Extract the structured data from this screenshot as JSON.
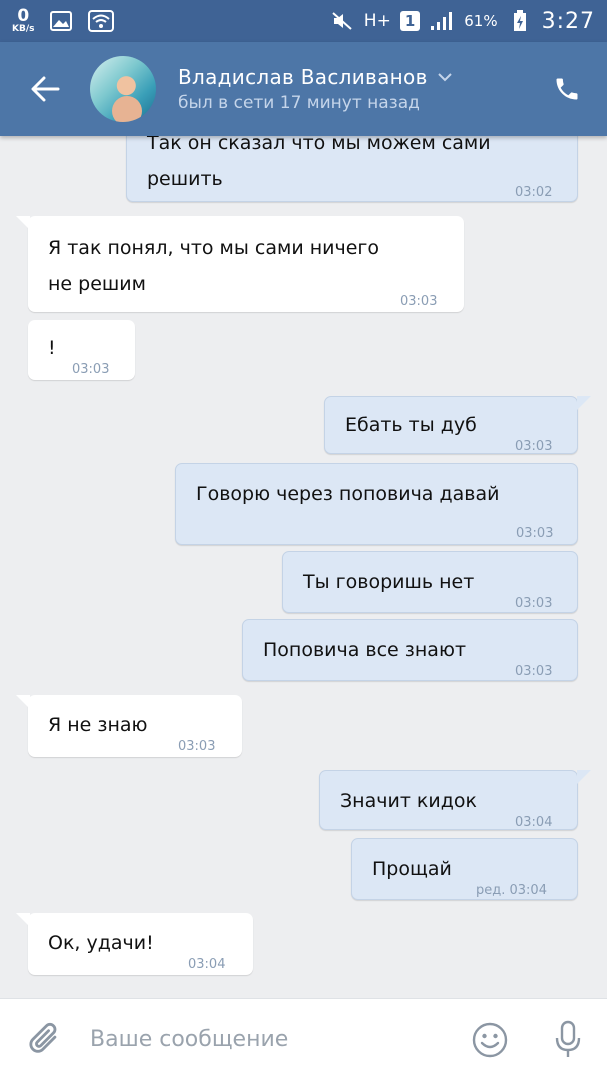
{
  "status_bar": {
    "speed_value": "0",
    "speed_unit": "KB/s",
    "network": "H+",
    "sim": "1",
    "battery_percent": "61%",
    "time": "3:27"
  },
  "header": {
    "contact_name": "Владислав Васливанов",
    "contact_status": "был в сети 17 минут назад"
  },
  "messages": [
    {
      "side": "out",
      "text": "Так он сказал что мы можем сами\nрешить",
      "time": "03:02"
    },
    {
      "side": "in",
      "text": "Я так понял, что мы сами ничего\nне решим",
      "time": "03:03"
    },
    {
      "side": "in",
      "text": "!",
      "time": "03:03"
    },
    {
      "side": "out",
      "text": "Ебать ты дуб",
      "time": "03:03"
    },
    {
      "side": "out",
      "text": "Говорю через поповича давай",
      "time": "03:03"
    },
    {
      "side": "out",
      "text": "Ты говоришь нет",
      "time": "03:03"
    },
    {
      "side": "out",
      "text": "Поповича все знают",
      "time": "03:03"
    },
    {
      "side": "in",
      "text": "Я не знаю",
      "time": "03:03"
    },
    {
      "side": "out",
      "text": "Значит кидок",
      "time": "03:04"
    },
    {
      "side": "out",
      "text": "Прощай",
      "time": "ред. 03:04"
    },
    {
      "side": "in",
      "text": "Ок, удачи!",
      "time": "03:04"
    }
  ],
  "composer": {
    "placeholder": "Ваше сообщение"
  },
  "colors": {
    "status_bar": "#3f6395",
    "header": "#4d76a7",
    "background": "#edeef0",
    "bubble_in": "#ffffff",
    "bubble_out": "#dce7f5"
  }
}
